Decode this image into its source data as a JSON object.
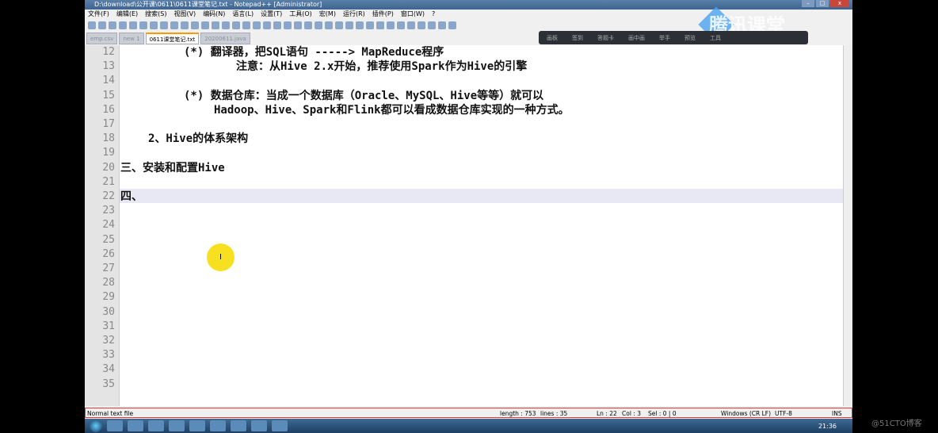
{
  "window": {
    "title": "D:\\download\\公开课\\0611\\0611课堂笔记.txt - Notepad++ [Administrator]",
    "min": "–",
    "max": "□",
    "close": "x"
  },
  "menu": [
    "文件(F)",
    "编辑(E)",
    "搜索(S)",
    "视图(V)",
    "编码(N)",
    "语言(L)",
    "设置(T)",
    "工具(O)",
    "宏(M)",
    "运行(R)",
    "插件(P)",
    "窗口(W)",
    "?"
  ],
  "tabs": [
    {
      "label": "emp.csv"
    },
    {
      "label": "new 1"
    },
    {
      "label": "0611课堂笔记.txt",
      "active": true
    },
    {
      "label": "20200611.java"
    }
  ],
  "overlay": {
    "items": [
      "画板",
      "签到",
      "答题卡",
      "画中画",
      "举手",
      "预览",
      "工具"
    ],
    "brand": "腾讯课堂"
  },
  "editor": {
    "current_line": 22,
    "lines": [
      {
        "n": "12",
        "text": "(*) 翻译器，把SQL语句 -----> MapReduce程序",
        "indent": 82
      },
      {
        "n": "13",
        "text": "注意：从Hive 2.x开始，推荐使用Spark作为Hive的引擎",
        "indent": 148
      },
      {
        "n": "14",
        "text": "",
        "indent": 0
      },
      {
        "n": "15",
        "text": "(*) 数据仓库：当成一个数据库（Oracle、MySQL、Hive等等）就可以",
        "indent": 82
      },
      {
        "n": "16",
        "text": "Hadoop、Hive、Spark和Flink都可以看成数据仓库实现的一种方式。",
        "indent": 120
      },
      {
        "n": "17",
        "text": "",
        "indent": 0
      },
      {
        "n": "18",
        "text": "2、Hive的体系架构",
        "indent": 37
      },
      {
        "n": "19",
        "text": "",
        "indent": 0
      },
      {
        "n": "20",
        "text": "三、安装和配置Hive",
        "indent": 2
      },
      {
        "n": "21",
        "text": "",
        "indent": 0
      },
      {
        "n": "22",
        "text": "四、",
        "indent": 2
      },
      {
        "n": "23",
        "text": ""
      },
      {
        "n": "24",
        "text": ""
      },
      {
        "n": "25",
        "text": ""
      },
      {
        "n": "26",
        "text": ""
      },
      {
        "n": "27",
        "text": ""
      },
      {
        "n": "28",
        "text": ""
      },
      {
        "n": "29",
        "text": ""
      },
      {
        "n": "30",
        "text": ""
      },
      {
        "n": "31",
        "text": ""
      },
      {
        "n": "32",
        "text": ""
      },
      {
        "n": "33",
        "text": ""
      },
      {
        "n": "34",
        "text": ""
      },
      {
        "n": "35",
        "text": ""
      }
    ]
  },
  "status": {
    "type": "Normal text file",
    "length": "length : 753",
    "lines": "lines : 35",
    "ln": "Ln : 22",
    "col": "Col : 3",
    "sel": "Sel : 0 | 0",
    "eol": "Windows (CR LF)",
    "enc": "UTF-8",
    "mode": "INS"
  },
  "taskbar": {
    "clock": "21:36"
  },
  "cursor": "I",
  "watermark": "@51CTO博客"
}
